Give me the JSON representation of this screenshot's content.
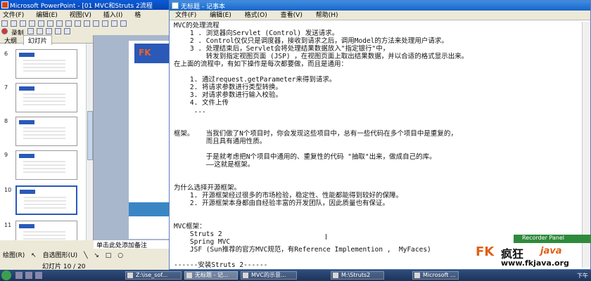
{
  "ppt": {
    "title": "Microsoft PowerPoint - [01 MVC和Struts 2流程",
    "menu": [
      "文件(F)",
      "编辑(E)",
      "视图(V)",
      "插入(I)",
      "格"
    ],
    "record_label": "录制",
    "tabs": [
      "大纲",
      "幻灯片"
    ],
    "slide_numbers": [
      "6",
      "7",
      "8",
      "9",
      "10",
      "11"
    ],
    "selected_slide": "10",
    "logo_text": "FK",
    "notes_hint": "单击此处添加备注",
    "draw_label": "绘图(R)",
    "autoshape_label": "自选图形(U)",
    "status": "幻灯片 10 / 20"
  },
  "notepad": {
    "title": "无标题 - 记事本",
    "menu": [
      "文件(F)",
      "编辑(E)",
      "格式(O)",
      "查看(V)",
      "帮助(H)"
    ],
    "lines": [
      "MVC的处理流程",
      "    1 . 浏览器向Servlet (Control) 发送请求。",
      "    2 . Control仅仅只是调度器，接收到请求之后，调用Model的方法来处理用户请求。",
      "    3 . 处理结束后，Servlet会将处理结果数据放入\"指定银行\"中，",
      "        转发到指定视图页面 (JSP) ，在视图页面上取出结果数据，并以合适的格式显示出来。",
      "在上面的流程中，有如下操作是每次都要做，而且是通用：",
      "",
      "    1. 通过request.getParameter来得到请求。",
      "    2. 将请求参数进行类型转换。",
      "    3. 对请求参数进行输入校验。",
      "    4. 文件上传",
      "     ...",
      "",
      "",
      "框架。   当我们做了N个项目时，你会发现这些项目中，总有一些代码在多个项目中是重复的，",
      "        而且具有通用性质。",
      "",
      "        于是就考虑把N个项目中通用的、重复性的代码 \"抽取\"出来，做成自己的库。",
      "        ——这就是框架。",
      "",
      "",
      "为什么选择开源框架。",
      "    1. 开源框架经过很多的市场检验，稳定性、性能都能得到较好的保障。",
      "    2. 开源框架本身都由自经验丰富的开发团队，因此质量也有保证。",
      "",
      "",
      "MVC框架：",
      "    Struts 2",
      "    Spring MVC",
      "    JSF (Sun推荐的官方MVC规范，有Reference Implemention ,  MyFaces)",
      "",
      "------安装Struts 2------",
      "",
      "|"
    ]
  },
  "overlay": {
    "recorder_panel": "Recorder Panel",
    "watermark_fk": "FK",
    "watermark_cn": "疯狂",
    "watermark_java": "java",
    "watermark_url": "www.fkjava.org"
  },
  "taskbar": {
    "tasks": [
      "无标题 - 记...",
      "Z:\\ise_sof...",
      "MVC的示意...",
      "M:\\Struts2",
      "Microsoft ..."
    ],
    "clock": "下午"
  }
}
